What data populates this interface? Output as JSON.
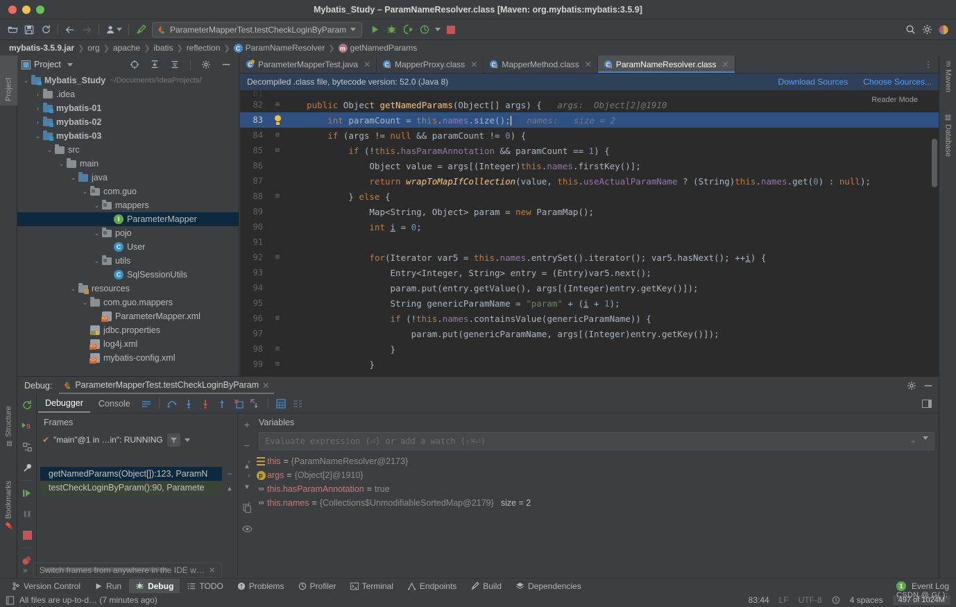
{
  "window": {
    "title": "Mybatis_Study – ParamNameResolver.class [Maven: org.mybatis:mybatis:3.5.9]"
  },
  "toolbar": {
    "run_config": "ParameterMapperTest.testCheckLoginByParam",
    "icons": [
      "open-folder-icon",
      "save-icon",
      "sync-icon",
      "back-arrow-icon",
      "forward-arrow-icon",
      "user-profile-icon",
      "build-hammer-icon"
    ],
    "run_button": "run-icon",
    "debug_button": "debug-icon",
    "coverage_button": "run-with-coverage-icon",
    "profile_button": "profiler-icon",
    "stop_button": "stop-icon",
    "search_icon": "search-icon",
    "settings_icon": "gear-icon",
    "account_icon": "account-icon"
  },
  "breadcrumb": {
    "items": [
      {
        "label": "mybatis-3.5.9.jar",
        "bold": true,
        "icon": ""
      },
      {
        "label": "org",
        "bold": false,
        "icon": ""
      },
      {
        "label": "apache",
        "bold": false,
        "icon": ""
      },
      {
        "label": "ibatis",
        "bold": false,
        "icon": ""
      },
      {
        "label": "reflection",
        "bold": false,
        "icon": ""
      },
      {
        "label": "ParamNameResolver",
        "bold": false,
        "icon": "C"
      },
      {
        "label": "getNamedParams",
        "bold": false,
        "icon": "m"
      }
    ]
  },
  "left_rail": {
    "project": "Project",
    "structure": "Structure",
    "bookmarks": "Bookmarks"
  },
  "right_rail": {
    "maven": "Maven",
    "database": "Database"
  },
  "project_panel": {
    "title": "Project",
    "tree": [
      {
        "depth": 0,
        "chev": "v",
        "icon": "module-folder",
        "label": "Mybatis_Study",
        "bold": true,
        "path": "~/Documents/IdeaProjects/",
        "selected": false
      },
      {
        "depth": 1,
        "chev": ">",
        "icon": "folder",
        "label": ".idea",
        "bold": false,
        "path": "",
        "selected": false
      },
      {
        "depth": 1,
        "chev": ">",
        "icon": "module-folder",
        "label": "mybatis-01",
        "bold": true,
        "path": "",
        "selected": false
      },
      {
        "depth": 1,
        "chev": ">",
        "icon": "module-folder",
        "label": "mybatis-02",
        "bold": true,
        "path": "",
        "selected": false
      },
      {
        "depth": 1,
        "chev": "v",
        "icon": "module-folder",
        "label": "mybatis-03",
        "bold": true,
        "path": "",
        "selected": false
      },
      {
        "depth": 2,
        "chev": "v",
        "icon": "folder",
        "label": "src",
        "bold": false,
        "path": "",
        "selected": false
      },
      {
        "depth": 3,
        "chev": "v",
        "icon": "folder",
        "label": "main",
        "bold": false,
        "path": "",
        "selected": false
      },
      {
        "depth": 4,
        "chev": "v",
        "icon": "source-folder",
        "label": "java",
        "bold": false,
        "path": "",
        "selected": false
      },
      {
        "depth": 5,
        "chev": "v",
        "icon": "package",
        "label": "com.guo",
        "bold": false,
        "path": "",
        "selected": false
      },
      {
        "depth": 6,
        "chev": "v",
        "icon": "package",
        "label": "mappers",
        "bold": false,
        "path": "",
        "selected": false
      },
      {
        "depth": 7,
        "chev": "",
        "icon": "interface",
        "label": "ParameterMapper",
        "bold": false,
        "path": "",
        "selected": true
      },
      {
        "depth": 6,
        "chev": "v",
        "icon": "package",
        "label": "pojo",
        "bold": false,
        "path": "",
        "selected": false
      },
      {
        "depth": 7,
        "chev": "",
        "icon": "class",
        "label": "User",
        "bold": false,
        "path": "",
        "selected": false
      },
      {
        "depth": 6,
        "chev": "v",
        "icon": "package",
        "label": "utils",
        "bold": false,
        "path": "",
        "selected": false
      },
      {
        "depth": 7,
        "chev": "",
        "icon": "class",
        "label": "SqlSessionUtils",
        "bold": false,
        "path": "",
        "selected": false
      },
      {
        "depth": 4,
        "chev": "v",
        "icon": "resource-folder",
        "label": "resources",
        "bold": false,
        "path": "",
        "selected": false
      },
      {
        "depth": 5,
        "chev": "v",
        "icon": "folder",
        "label": "com.guo.mappers",
        "bold": false,
        "path": "",
        "selected": false
      },
      {
        "depth": 6,
        "chev": "",
        "icon": "xml",
        "label": "ParameterMapper.xml",
        "bold": false,
        "path": "",
        "selected": false
      },
      {
        "depth": 5,
        "chev": "",
        "icon": "properties",
        "label": "jdbc.properties",
        "bold": false,
        "path": "",
        "selected": false
      },
      {
        "depth": 5,
        "chev": "",
        "icon": "xml",
        "label": "log4j.xml",
        "bold": false,
        "path": "",
        "selected": false
      },
      {
        "depth": 5,
        "chev": "",
        "icon": "xml",
        "label": "mybatis-config.xml",
        "bold": false,
        "path": "",
        "selected": false
      }
    ]
  },
  "editor": {
    "tabs": [
      {
        "label": "ParameterMapperTest.java",
        "icon": "java-class-icon",
        "active": false
      },
      {
        "label": "MapperProxy.class",
        "icon": "class-file-icon",
        "active": false
      },
      {
        "label": "MapperMethod.class",
        "icon": "class-file-icon",
        "active": false
      },
      {
        "label": "ParamNameResolver.class",
        "icon": "class-file-icon",
        "active": true
      }
    ],
    "notice": {
      "text": "Decompiled .class file, bytecode version: 52.0 (Java 8)",
      "download_sources": "Download Sources",
      "choose_sources": "Choose Sources..."
    },
    "reader_mode": "Reader Mode",
    "lines": [
      {
        "no": "81",
        "marker": "",
        "highlight": false,
        "partial": true,
        "tokens": []
      },
      {
        "no": "82",
        "marker": "fold-open",
        "highlight": false,
        "tokens": [
          {
            "t": "    ",
            "c": "st"
          },
          {
            "t": "public ",
            "c": "k"
          },
          {
            "t": "Object ",
            "c": "st"
          },
          {
            "t": "getNamedParams",
            "c": "m"
          },
          {
            "t": "(Object[] args) {",
            "c": "st"
          },
          {
            "t": "   args:  Object[2]@1910",
            "c": "hint"
          }
        ]
      },
      {
        "no": "83",
        "marker": "bulb",
        "highlight": true,
        "tokens": [
          {
            "t": "        ",
            "c": "st"
          },
          {
            "t": "int ",
            "c": "k"
          },
          {
            "t": "paramCount = ",
            "c": "st"
          },
          {
            "t": "this",
            "c": "k"
          },
          {
            "t": ".",
            "c": "st"
          },
          {
            "t": "names",
            "c": "f"
          },
          {
            "t": ".size();",
            "c": "st"
          },
          {
            "t": "|",
            "c": "caret"
          },
          {
            "t": "   names:   size = 2",
            "c": "hint"
          }
        ]
      },
      {
        "no": "84",
        "marker": "fold-open",
        "highlight": false,
        "tokens": [
          {
            "t": "        ",
            "c": "st"
          },
          {
            "t": "if ",
            "c": "k"
          },
          {
            "t": "(args != ",
            "c": "st"
          },
          {
            "t": "null ",
            "c": "k"
          },
          {
            "t": "&& paramCount != ",
            "c": "st"
          },
          {
            "t": "0",
            "c": "n"
          },
          {
            "t": ") {",
            "c": "st"
          }
        ]
      },
      {
        "no": "85",
        "marker": "fold-open",
        "highlight": false,
        "tokens": [
          {
            "t": "            ",
            "c": "st"
          },
          {
            "t": "if ",
            "c": "k"
          },
          {
            "t": "(!",
            "c": "st"
          },
          {
            "t": "this",
            "c": "k"
          },
          {
            "t": ".",
            "c": "st"
          },
          {
            "t": "hasParamAnnotation",
            "c": "f"
          },
          {
            "t": " && paramCount == ",
            "c": "st"
          },
          {
            "t": "1",
            "c": "n"
          },
          {
            "t": ") {",
            "c": "st"
          }
        ]
      },
      {
        "no": "86",
        "marker": "",
        "highlight": false,
        "tokens": [
          {
            "t": "                Object value = args[(Integer)",
            "c": "st"
          },
          {
            "t": "this",
            "c": "k"
          },
          {
            "t": ".",
            "c": "st"
          },
          {
            "t": "names",
            "c": "f"
          },
          {
            "t": ".firstKey()];",
            "c": "st"
          }
        ]
      },
      {
        "no": "87",
        "marker": "",
        "highlight": false,
        "tokens": [
          {
            "t": "                ",
            "c": "st"
          },
          {
            "t": "return ",
            "c": "k"
          },
          {
            "t": "wrapToMapIfCollection",
            "c": "mi"
          },
          {
            "t": "(value, ",
            "c": "st"
          },
          {
            "t": "this",
            "c": "k"
          },
          {
            "t": ".",
            "c": "st"
          },
          {
            "t": "useActualParamName",
            "c": "f"
          },
          {
            "t": " ? (String)",
            "c": "st"
          },
          {
            "t": "this",
            "c": "k"
          },
          {
            "t": ".",
            "c": "st"
          },
          {
            "t": "names",
            "c": "f"
          },
          {
            "t": ".get(",
            "c": "st"
          },
          {
            "t": "0",
            "c": "n"
          },
          {
            "t": ") : ",
            "c": "st"
          },
          {
            "t": "null",
            "c": "k"
          },
          {
            "t": ");",
            "c": "st"
          }
        ]
      },
      {
        "no": "88",
        "marker": "fold-close",
        "highlight": false,
        "tokens": [
          {
            "t": "            } ",
            "c": "st"
          },
          {
            "t": "else ",
            "c": "k"
          },
          {
            "t": "{",
            "c": "st"
          }
        ]
      },
      {
        "no": "89",
        "marker": "",
        "highlight": false,
        "tokens": [
          {
            "t": "                Map<String, Object> param = ",
            "c": "st"
          },
          {
            "t": "new ",
            "c": "k"
          },
          {
            "t": "ParamMap();",
            "c": "st"
          }
        ]
      },
      {
        "no": "90",
        "marker": "",
        "highlight": false,
        "tokens": [
          {
            "t": "                ",
            "c": "st"
          },
          {
            "t": "int ",
            "c": "k"
          },
          {
            "t": "i",
            "c": "u"
          },
          {
            "t": " = ",
            "c": "st"
          },
          {
            "t": "0",
            "c": "n"
          },
          {
            "t": ";",
            "c": "st"
          }
        ]
      },
      {
        "no": "91",
        "marker": "",
        "highlight": false,
        "tokens": []
      },
      {
        "no": "92",
        "marker": "fold-open",
        "highlight": false,
        "tokens": [
          {
            "t": "                ",
            "c": "st"
          },
          {
            "t": "for",
            "c": "k"
          },
          {
            "t": "(Iterator var5 = ",
            "c": "st"
          },
          {
            "t": "this",
            "c": "k"
          },
          {
            "t": ".",
            "c": "st"
          },
          {
            "t": "names",
            "c": "f"
          },
          {
            "t": ".entrySet().iterator(); var5.hasNext(); ++",
            "c": "st"
          },
          {
            "t": "i",
            "c": "u"
          },
          {
            "t": ") {",
            "c": "st"
          }
        ]
      },
      {
        "no": "93",
        "marker": "",
        "highlight": false,
        "tokens": [
          {
            "t": "                    Entry<Integer, String> entry = (Entry)var5.next();",
            "c": "st"
          }
        ]
      },
      {
        "no": "94",
        "marker": "",
        "highlight": false,
        "tokens": [
          {
            "t": "                    param.put(entry.getValue(), args[(Integer)entry.getKey()]);",
            "c": "st"
          }
        ]
      },
      {
        "no": "95",
        "marker": "",
        "highlight": false,
        "tokens": [
          {
            "t": "                    String genericParamName = ",
            "c": "st"
          },
          {
            "t": "\"param\"",
            "c": "s"
          },
          {
            "t": " + (",
            "c": "st"
          },
          {
            "t": "i",
            "c": "u"
          },
          {
            "t": " + ",
            "c": "st"
          },
          {
            "t": "1",
            "c": "n"
          },
          {
            "t": ");",
            "c": "st"
          }
        ]
      },
      {
        "no": "96",
        "marker": "fold-open",
        "highlight": false,
        "tokens": [
          {
            "t": "                    ",
            "c": "st"
          },
          {
            "t": "if ",
            "c": "k"
          },
          {
            "t": "(!",
            "c": "st"
          },
          {
            "t": "this",
            "c": "k"
          },
          {
            "t": ".",
            "c": "st"
          },
          {
            "t": "names",
            "c": "f"
          },
          {
            "t": ".containsValue(genericParamName)) {",
            "c": "st"
          }
        ]
      },
      {
        "no": "97",
        "marker": "",
        "highlight": false,
        "tokens": [
          {
            "t": "                        param.put(genericParamName, args[(Integer)entry.getKey()]);",
            "c": "st"
          }
        ]
      },
      {
        "no": "98",
        "marker": "fold-close",
        "highlight": false,
        "tokens": [
          {
            "t": "                    }",
            "c": "st"
          }
        ]
      },
      {
        "no": "99",
        "marker": "fold-close",
        "highlight": false,
        "tokens": [
          {
            "t": "                }",
            "c": "st"
          }
        ]
      }
    ]
  },
  "debug": {
    "label": "Debug:",
    "session_tab": "ParameterMapperTest.testCheckLoginByParam",
    "tabs": [
      {
        "label": "Debugger",
        "active": true
      },
      {
        "label": "Console",
        "active": false
      }
    ],
    "step_icons": [
      "show-execution-point-icon",
      "step-over-icon",
      "step-into-icon",
      "force-step-into-icon",
      "step-out-icon",
      "drop-frame-icon",
      "run-to-cursor-icon",
      "evaluate-expression-icon",
      "layout-icon"
    ],
    "side_icons": [
      "rerun-icon",
      "stop-9-icon",
      "restore-layout-icon",
      "settings-wrench-icon",
      "resume-icon",
      "pause-icon",
      "stop-square-icon",
      "mute-breakpoints-icon"
    ],
    "frames": {
      "header": "Frames",
      "thread": "\"main\"@1 in …in\": RUNNING",
      "filter_icon": "filter-icon",
      "add_icon": "add-icon",
      "rows": [
        {
          "label": "getNamedParams(Object[]):123, ParamN",
          "selected": true
        },
        {
          "label": "testCheckLoginByParam():90, Paramete",
          "selected": false
        }
      ]
    },
    "variables": {
      "header": "Variables",
      "evaluate_placeholder": "Evaluate expression (⏎) or add a watch (⇧⌘⏎)",
      "rows": [
        {
          "chev": ">",
          "icon": "field-icon",
          "name": "this",
          "value": "{ParamNameResolver@2173}",
          "size": ""
        },
        {
          "chev": ">",
          "icon": "param-icon",
          "name": "args",
          "value": "{Object[2]@1910}",
          "size": ""
        },
        {
          "chev": "",
          "icon": "final-field-icon",
          "name": "this.hasParamAnnotation",
          "value": "true",
          "size": ""
        },
        {
          "chev": ">",
          "icon": "final-field-icon",
          "name": "this.names",
          "value": "{Collections$UnmodifiableSortedMap@2179}",
          "size": "size = 2"
        }
      ]
    },
    "hint": "Switch frames from anywhere in the IDE w…"
  },
  "statusbar": {
    "items": [
      {
        "label": "Version Control",
        "icon": "branch-icon",
        "active": false
      },
      {
        "label": "Run",
        "icon": "run-icon",
        "active": false
      },
      {
        "label": "Debug",
        "icon": "debug-icon",
        "active": true
      },
      {
        "label": "TODO",
        "icon": "todo-icon",
        "active": false
      },
      {
        "label": "Problems",
        "icon": "problems-icon",
        "active": false
      },
      {
        "label": "Profiler",
        "icon": "profiler-icon",
        "active": false
      },
      {
        "label": "Terminal",
        "icon": "terminal-icon",
        "active": false
      },
      {
        "label": "Endpoints",
        "icon": "endpoints-icon",
        "active": false
      },
      {
        "label": "Build",
        "icon": "build-icon",
        "active": false
      },
      {
        "label": "Dependencies",
        "icon": "dependencies-icon",
        "active": false
      }
    ],
    "event_log": "Event Log",
    "event_count": "1",
    "message": "All files are up-to-d… (7 minutes ago)",
    "position": "83:44",
    "line_sep": "LF",
    "encoding": "UTF-8",
    "indent": "4 spaces",
    "memory": "497 of 1024M",
    "watermark": "CSDN @ G( );"
  }
}
